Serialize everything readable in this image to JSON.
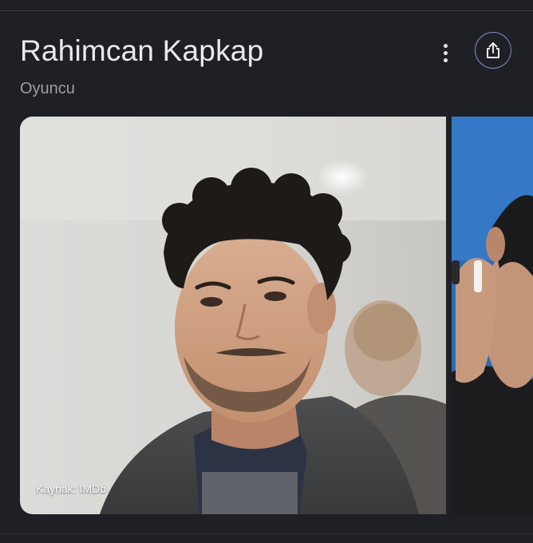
{
  "card": {
    "title": "Rahimcan Kapkap",
    "subtitle": "Oyuncu"
  },
  "actions": {
    "more_icon": "more-vertical-icon",
    "share_icon": "share-icon"
  },
  "images": [
    {
      "caption": "Kaynak: IMDb"
    },
    {
      "caption": ""
    }
  ],
  "colors": {
    "background": "#1f2025",
    "title_text": "#e8eaed",
    "subtitle_text": "#9aa0a6",
    "share_ring": "#7b8ec3"
  }
}
